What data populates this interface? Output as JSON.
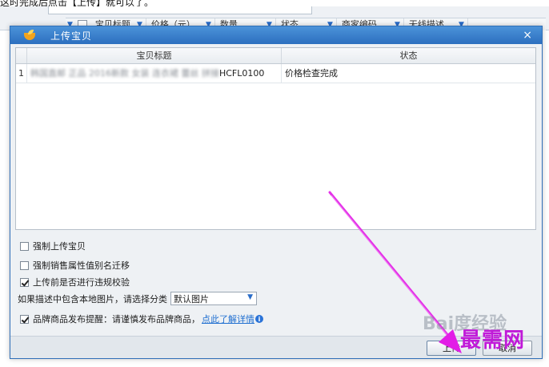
{
  "caption": "这时完成后点击【上传】就可以了。",
  "background": {
    "columns": [
      {
        "label": "宝贝标题",
        "w": 70
      },
      {
        "label": "价格（元）",
        "w": 86
      },
      {
        "label": "数量",
        "w": 76
      },
      {
        "label": "状态",
        "w": 76
      },
      {
        "label": "商家编码",
        "w": 84
      },
      {
        "label": "无线描述",
        "w": 80
      }
    ]
  },
  "dialog": {
    "title": "上传宝贝",
    "close": "×",
    "grid": {
      "headers": {
        "title": "宝贝标题",
        "status": "状态"
      },
      "rows": [
        {
          "index": "1",
          "title_blurred": "韩国直邮 正品 2016新款 女装 连衣裙 蕾丝 拼接",
          "title_code": "HCFL0100",
          "status": "价格检查完成"
        }
      ]
    },
    "options": {
      "force_upload": "强制上传宝贝",
      "force_alias": "强制销售属性值别名迁移",
      "violation_check": "上传前是否进行违规校验",
      "local_image_label": "如果描述中包含本地图片，请选择分类",
      "local_image_value": "默认图片",
      "brand_reminder": "品牌商品发布提醒：请谨慎发布品牌商品，",
      "brand_link": "点此了解详情"
    },
    "buttons": {
      "upload": "上传",
      "cancel": "取消"
    }
  },
  "watermarks": {
    "baidu": "Bai度经验",
    "brand": "最需网"
  },
  "colors": {
    "titlebar": "#2c6fbf",
    "arrow": "#e21de6",
    "brand": "#c01ad8"
  }
}
